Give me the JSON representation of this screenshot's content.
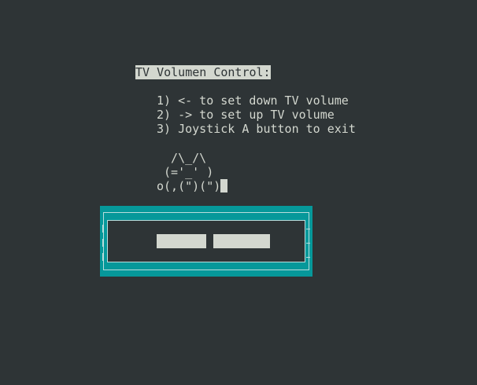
{
  "terminal": {
    "title": "TV Volumen Control:",
    "instructions": [
      "1) <- to set down TV volume",
      "2) -> to set up TV volume",
      "3) Joystick A button to exit"
    ],
    "ascii_art": [
      "  /\\_/\\",
      " (='_' )",
      "o(,(\")(\")"
    ]
  },
  "volume_widget": {
    "accent_color": "#06989a",
    "background_color": "#2e3436",
    "bar_color": "#d3d7cf",
    "blocks_filled": 2
  }
}
